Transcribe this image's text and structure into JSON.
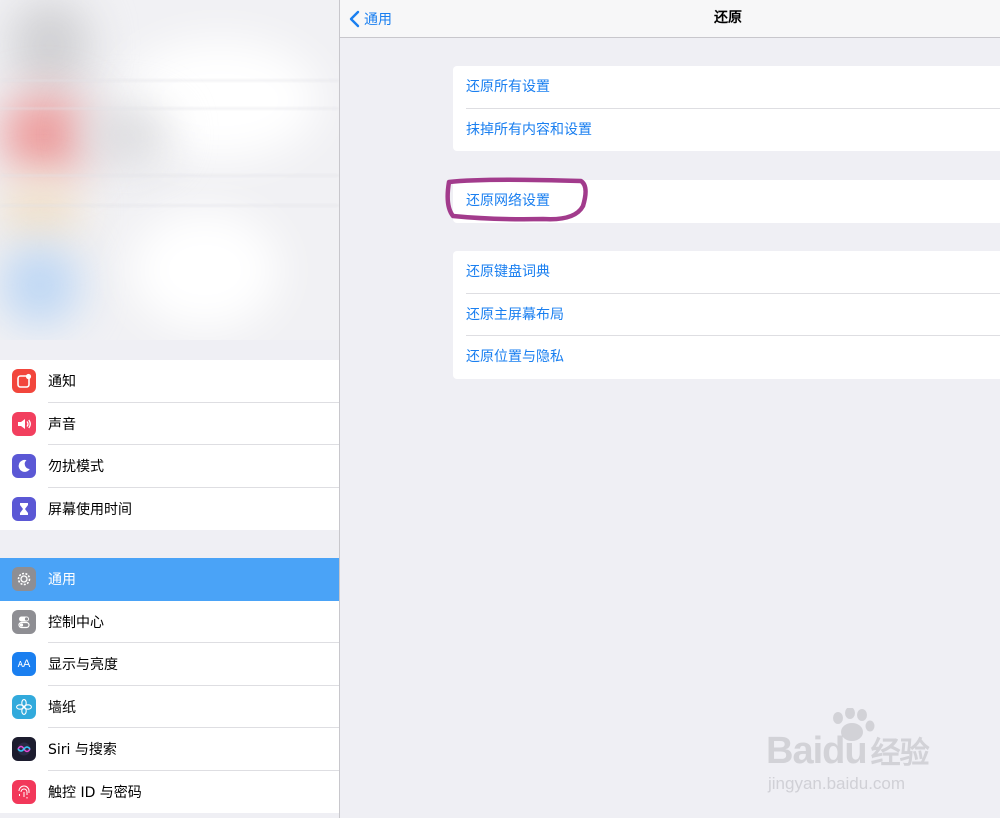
{
  "sidebar": {
    "group1": [
      {
        "label": "通知",
        "icon": "notifications-icon",
        "color": "#f2463c"
      },
      {
        "label": "声音",
        "icon": "speaker-icon",
        "color": "#f23f5e"
      },
      {
        "label": "勿扰模式",
        "icon": "moon-icon",
        "color": "#5b58d5"
      },
      {
        "label": "屏幕使用时间",
        "icon": "hourglass-icon",
        "color": "#5b58d5"
      }
    ],
    "group2": [
      {
        "label": "通用",
        "icon": "gear-icon",
        "color": "#8e8e93",
        "selected": true
      },
      {
        "label": "控制中心",
        "icon": "toggles-icon",
        "color": "#8e8e93"
      },
      {
        "label": "显示与亮度",
        "icon": "display-brightness-icon",
        "color": "#1a7ff0"
      },
      {
        "label": "墙纸",
        "icon": "wallpaper-flower-icon",
        "color": "#32aadc"
      },
      {
        "label": "Siri 与搜索",
        "icon": "siri-icon",
        "color": "#1c1c2e"
      },
      {
        "label": "触控 ID 与密码",
        "icon": "fingerprint-icon",
        "color": "#f2385a"
      }
    ]
  },
  "navbar": {
    "back_label": "通用",
    "title": "还原"
  },
  "cards": {
    "card1": [
      "还原所有设置",
      "抹掉所有内容和设置"
    ],
    "card2": [
      "还原网络设置"
    ],
    "card3": [
      "还原键盘词典",
      "还原主屏幕布局",
      "还原位置与隐私"
    ]
  },
  "annotation": {
    "highlight_color": "#a23b8c"
  },
  "watermark": {
    "brand": "Bai",
    "brand_du": "du",
    "brand_cn": "经验",
    "url": "jingyan.baidu.com"
  },
  "colors": {
    "accent": "#1a7ff0",
    "selected_row": "#4aa3f7",
    "background": "#efeff4"
  }
}
